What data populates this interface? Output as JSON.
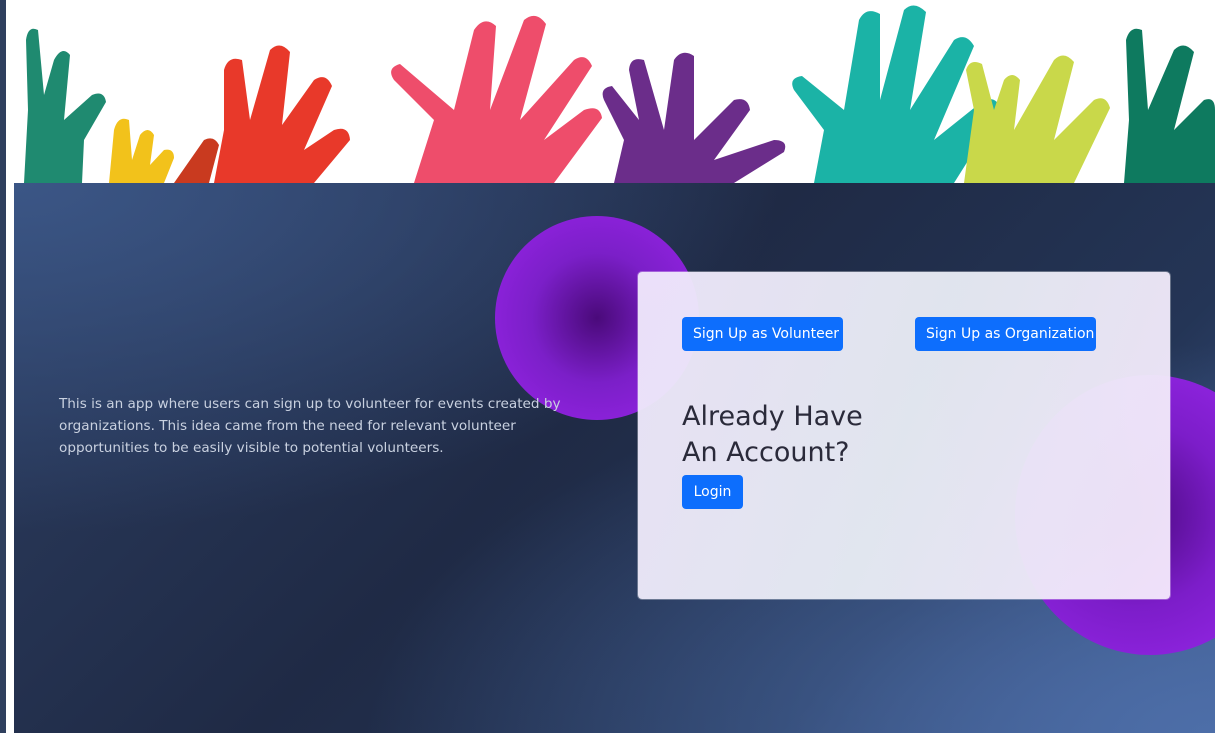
{
  "banner": {
    "alt": "Raised hands banner",
    "hand_colors": [
      "#1f8a70",
      "#f2c21b",
      "#e8392a",
      "#ee4d6b",
      "#6b2d8a",
      "#1bb3a6",
      "#c9d84a",
      "#0e7a5f"
    ]
  },
  "intro": {
    "description": "This is an app where users can sign up to volunteer for events created by organizations. This idea came from the need for relevant volunteer opportunities to be easily visible to potential volunteers."
  },
  "auth_card": {
    "signup_volunteer_label": "Sign Up as Volunteer",
    "signup_org_label": "Sign Up as Organization",
    "heading": "Already Have An Account?",
    "login_label": "Login"
  },
  "colors": {
    "primary_button": "#0d6efd",
    "blob_purple": "#9a24ea",
    "background_navy": "#1f2a45"
  }
}
